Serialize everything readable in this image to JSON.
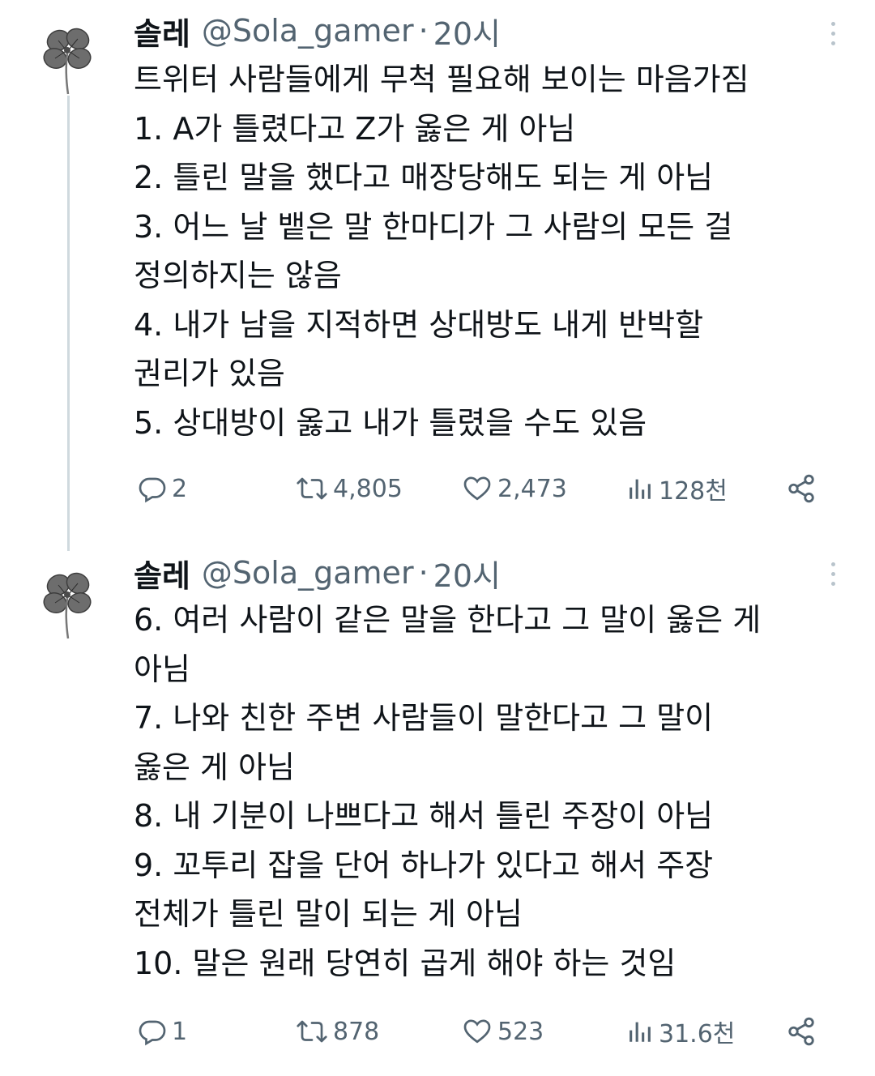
{
  "tweets": [
    {
      "name": "솔레",
      "handle": "@Sola_gamer",
      "separator": "·",
      "time": "20시",
      "lines": [
        "트위터 사람들에게 무척 필요해 보이는 마음가짐",
        "1. A가 틀렸다고 Z가 옳은 게 아님",
        "2. 틀린 말을 했다고 매장당해도 되는 게 아님",
        "3. 어느 날 뱉은 말 한마디가 그 사람의 모든 걸",
        "정의하지는 않음",
        "4. 내가 남을 지적하면 상대방도 내게 반박할",
        "권리가 있음",
        "5. 상대방이 옳고 내가 틀렸을 수도 있음"
      ],
      "replies": "2",
      "retweets": "4,805",
      "likes": "2,473",
      "views": "128천"
    },
    {
      "name": "솔레",
      "handle": "@Sola_gamer",
      "separator": "·",
      "time": "20시",
      "lines": [
        "6. 여러 사람이 같은 말을 한다고 그 말이 옳은 게",
        "아님",
        "7. 나와 친한 주변 사람들이 말한다고 그 말이",
        "옳은 게 아님",
        "8. 내 기분이 나쁘다고 해서 틀린 주장이 아님",
        "9. 꼬투리 잡을 단어 하나가 있다고 해서 주장",
        "전체가 틀린 말이 되는 게 아님",
        "10. 말은 원래 당연히 곱게 해야 하는 것임"
      ],
      "replies": "1",
      "retweets": "878",
      "likes": "523",
      "views": "31.6천"
    }
  ],
  "icons": {
    "avatar": "clover-avatar-icon",
    "reply": "reply-icon",
    "retweet": "retweet-icon",
    "like": "heart-icon",
    "views": "views-icon",
    "share": "share-icon",
    "more": "more-icon"
  },
  "colors": {
    "text": "#0f1419",
    "secondary": "#536471",
    "thread_line": "#cfd9de"
  }
}
